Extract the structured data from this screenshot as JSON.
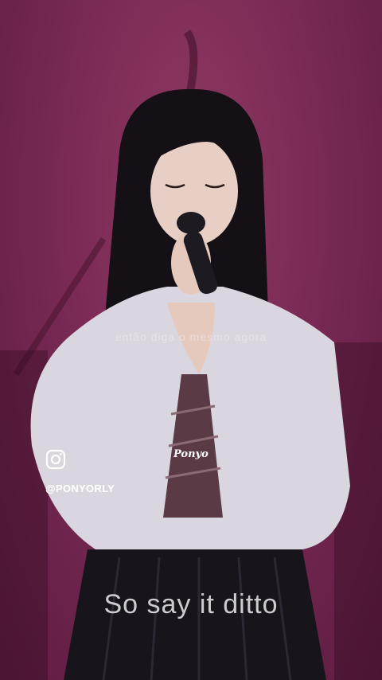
{
  "video": {
    "overlay_caption": "então diga o mesmo agora",
    "watermark_handle": "@PONYORLY",
    "watermark_logo": "Ponyo",
    "subtitle": "So say it ditto",
    "icons": [
      "instagram-icon"
    ]
  }
}
